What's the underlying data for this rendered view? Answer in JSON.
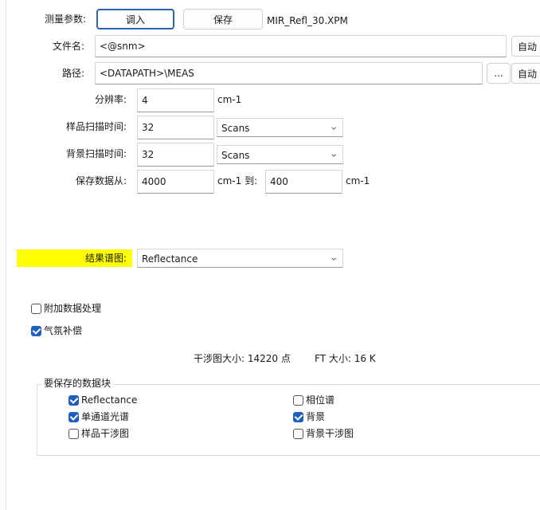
{
  "params": {
    "label": "测量参数:",
    "load_button": "调入",
    "save_button": "保存",
    "filename_display": "MIR_Refl_30.XPM"
  },
  "filename": {
    "label": "文件名:",
    "value": "<@snm>",
    "auto_button": "自动"
  },
  "path": {
    "label": "路径:",
    "value": "<DATAPATH>\\MEAS",
    "browse_button": "...",
    "auto_button": "自动"
  },
  "resolution": {
    "label": "分辨率:",
    "value": "4",
    "unit": "cm-1"
  },
  "sample_scan": {
    "label": "样品扫描时间:",
    "value": "32",
    "unit_select": "Scans"
  },
  "bg_scan": {
    "label": "背景扫描时间:",
    "value": "32",
    "unit_select": "Scans"
  },
  "save_range": {
    "label": "保存数据从:",
    "from": "4000",
    "from_unit": "cm-1 到:",
    "to": "400",
    "to_unit": "cm-1"
  },
  "result": {
    "label": "结果谱图:",
    "value": "Reflectance",
    "highlight_color": "#ffff00"
  },
  "options": {
    "extra_processing": {
      "label": "附加数据处理",
      "checked": false
    },
    "atmo_comp": {
      "label": "气氛补偿",
      "checked": true
    }
  },
  "info": {
    "interferogram_size": "干涉图大小: 14220 点",
    "ft_size": "FT 大小: 16 K"
  },
  "data_blocks": {
    "title": "要保存的数据块",
    "items": [
      {
        "label": "Reflectance",
        "checked": true
      },
      {
        "label": "相位谱",
        "checked": false
      },
      {
        "label": "单通道光谱",
        "checked": true
      },
      {
        "label": "背景",
        "checked": true
      },
      {
        "label": "样品干涉图",
        "checked": false
      },
      {
        "label": "背景干涉图",
        "checked": false
      }
    ]
  },
  "colors": {
    "accent": "#1f5fbf",
    "primary_border": "#2a62b8"
  }
}
